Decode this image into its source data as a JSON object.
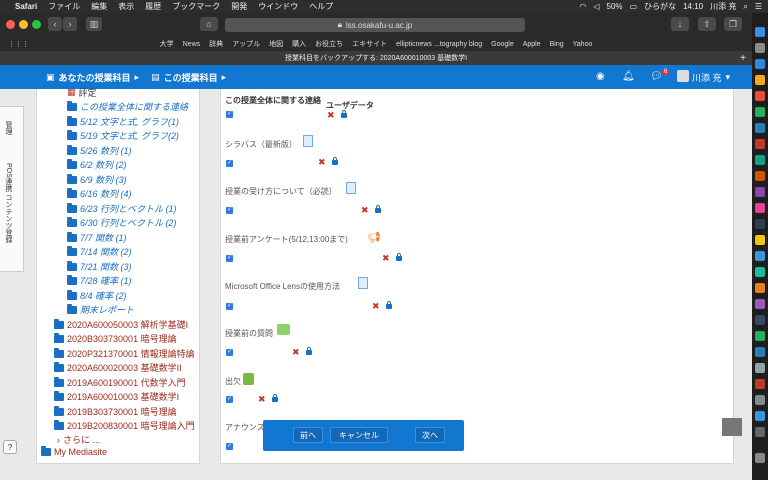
{
  "menubar": {
    "app": "Safari",
    "items": [
      "ファイル",
      "編集",
      "表示",
      "履歴",
      "ブックマーク",
      "開発",
      "ウインドウ",
      "ヘルプ"
    ],
    "battery": "50%",
    "input_mode": "ひらがな",
    "time": "14:10",
    "user": "川添 充"
  },
  "browser": {
    "url": "lss.osakafu-u.ac.jp",
    "favorites": [
      "大学",
      "News",
      "辞典",
      "アップル",
      "地図",
      "購入",
      "お役立ち",
      "エキサイト",
      "ellipticnews ...tography blog",
      "Google",
      "Apple",
      "Bing",
      "Yahoo"
    ],
    "tab_title": "授業科目をバックアップする: 2020A600010003 基礎数学I"
  },
  "navbar": {
    "my_courses": "あなたの授業科目",
    "this_course": "この授業科目",
    "notification_count": "6",
    "user_name": "川添 充"
  },
  "side_tabs": [
    "管理",
    "POS連携 コンテンツ登録"
  ],
  "left_tree": {
    "partial_top": "評定",
    "items": [
      {
        "label": "この授業全体に関する連絡",
        "kind": "link"
      },
      {
        "label": "5/12 文字と式, グラフ(1)",
        "kind": "link"
      },
      {
        "label": "5/19 文字と式, グラフ(2)",
        "kind": "link"
      },
      {
        "label": "5/26 数列 (1)",
        "kind": "link"
      },
      {
        "label": "6/2 数列 (2)",
        "kind": "link"
      },
      {
        "label": "6/9 数列 (3)",
        "kind": "link"
      },
      {
        "label": "6/16 数列 (4)",
        "kind": "link"
      },
      {
        "label": "6/23 行列とベクトル (1)",
        "kind": "link"
      },
      {
        "label": "6/30 行列とベクトル (2)",
        "kind": "link"
      },
      {
        "label": "7/7 関数 (1)",
        "kind": "link"
      },
      {
        "label": "7/14 関数 (2)",
        "kind": "link"
      },
      {
        "label": "7/21 関数 (3)",
        "kind": "link"
      },
      {
        "label": "7/28 確率 (1)",
        "kind": "link"
      },
      {
        "label": "8/4 確率 (2)",
        "kind": "link"
      },
      {
        "label": "期末レポート",
        "kind": "link"
      }
    ],
    "courses": [
      "2020A600050003 解析学基礎I",
      "2020B303730001 暗号理論",
      "2020P321370001 情報理論特論",
      "2020A600020003 基礎数学II",
      "2019A600190001 代数学入門",
      "2019A600010003 基礎数学I",
      "2019B303730001 暗号理論",
      "2019B200830001 暗号理論入門"
    ],
    "more": "さらに ...",
    "mediasite": "My Mediasite"
  },
  "main": {
    "section_title": "この授業全体に関する連絡",
    "user_data_header": "ユーザデータ",
    "items": [
      {
        "label": "シラバス（最新版）"
      },
      {
        "label": "授業の受け方について（必読）"
      },
      {
        "label": "授業前アンケート(5/12,13:00まで)"
      },
      {
        "label": "Microsoft Office Lensの使用方法"
      },
      {
        "label": "授業前の質問"
      },
      {
        "label": "出欠"
      },
      {
        "label": "アナウンス"
      }
    ]
  },
  "buttons": {
    "prev": "前へ",
    "cancel": "キャンセル",
    "next": "次へ"
  }
}
